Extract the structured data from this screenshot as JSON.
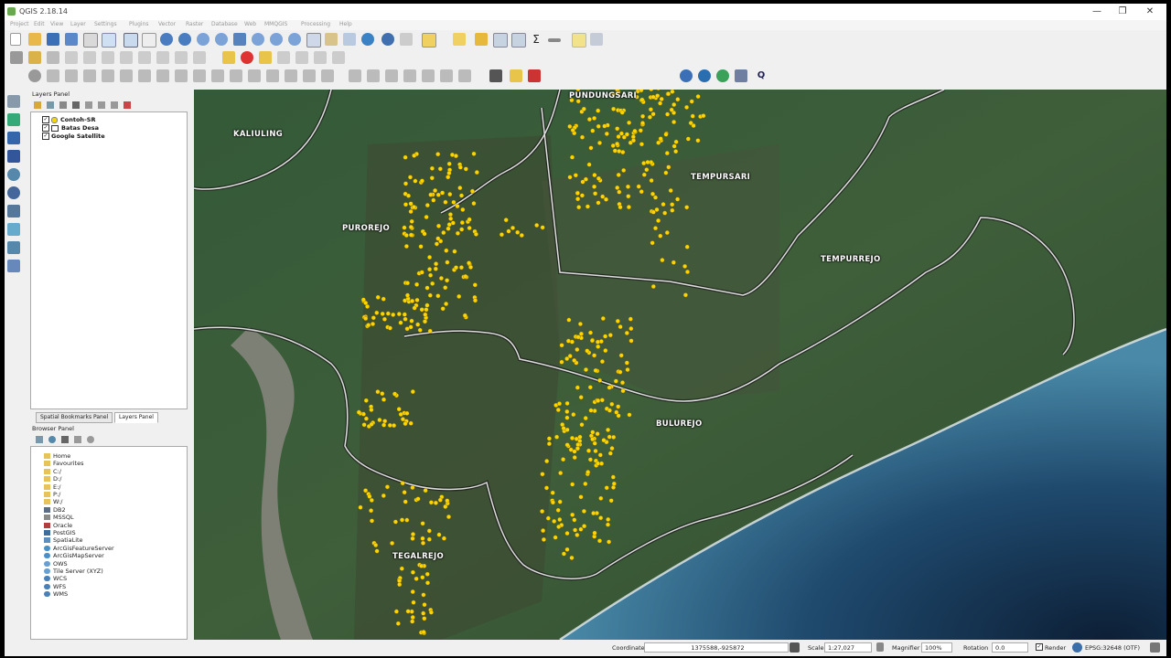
{
  "window": {
    "title": "QGIS 2.18.14",
    "minimize": "—",
    "maximize": "❐",
    "close": "✕"
  },
  "menu": [
    "Project",
    "Edit",
    "View",
    "Layer",
    "Settings",
    "Plugins",
    "Vector",
    "Raster",
    "Database",
    "Web",
    "MMQGIS",
    "Processing",
    "Help"
  ],
  "layers_panel": {
    "title": "Layers Panel",
    "layers": [
      {
        "name": "Contoh-SR",
        "checked": true
      },
      {
        "name": "Batas Desa",
        "checked": true
      },
      {
        "name": "Google Satellite",
        "checked": true
      }
    ]
  },
  "tabs": {
    "bookmarks": "Spatial Bookmarks Panel",
    "layers": "Layers Panel"
  },
  "browser_panel": {
    "title": "Browser Panel",
    "items": [
      "Home",
      "Favourites",
      "C:/",
      "D:/",
      "E:/",
      "P:/",
      "W:/",
      "DB2",
      "MSSQL",
      "Oracle",
      "PostGIS",
      "SpatiaLite",
      "ArcGisFeatureServer",
      "ArcGisMapServer",
      "OWS",
      "Tile Server (XYZ)",
      "WCS",
      "WFS",
      "WMS"
    ]
  },
  "map": {
    "places": [
      "PUNDUNGSARI",
      "KALIULING",
      "TEMPURSARI",
      "PUROREJO",
      "TEMPURREJO",
      "BULUREJO",
      "TEGALREJO"
    ],
    "point_color": "#ffd400",
    "boundary_color": "#d8d8d8"
  },
  "statusbar": {
    "coordinate_label": "Coordinate",
    "coordinate_value": "1375588,-925872",
    "scale_label": "Scale",
    "scale_value": "1:27,027",
    "magnifier_label": "Magnifier",
    "magnifier_value": "100%",
    "rotation_label": "Rotation",
    "rotation_value": "0.0",
    "render_label": "Render",
    "crs_label": "EPSG:32648 (OTF)"
  }
}
